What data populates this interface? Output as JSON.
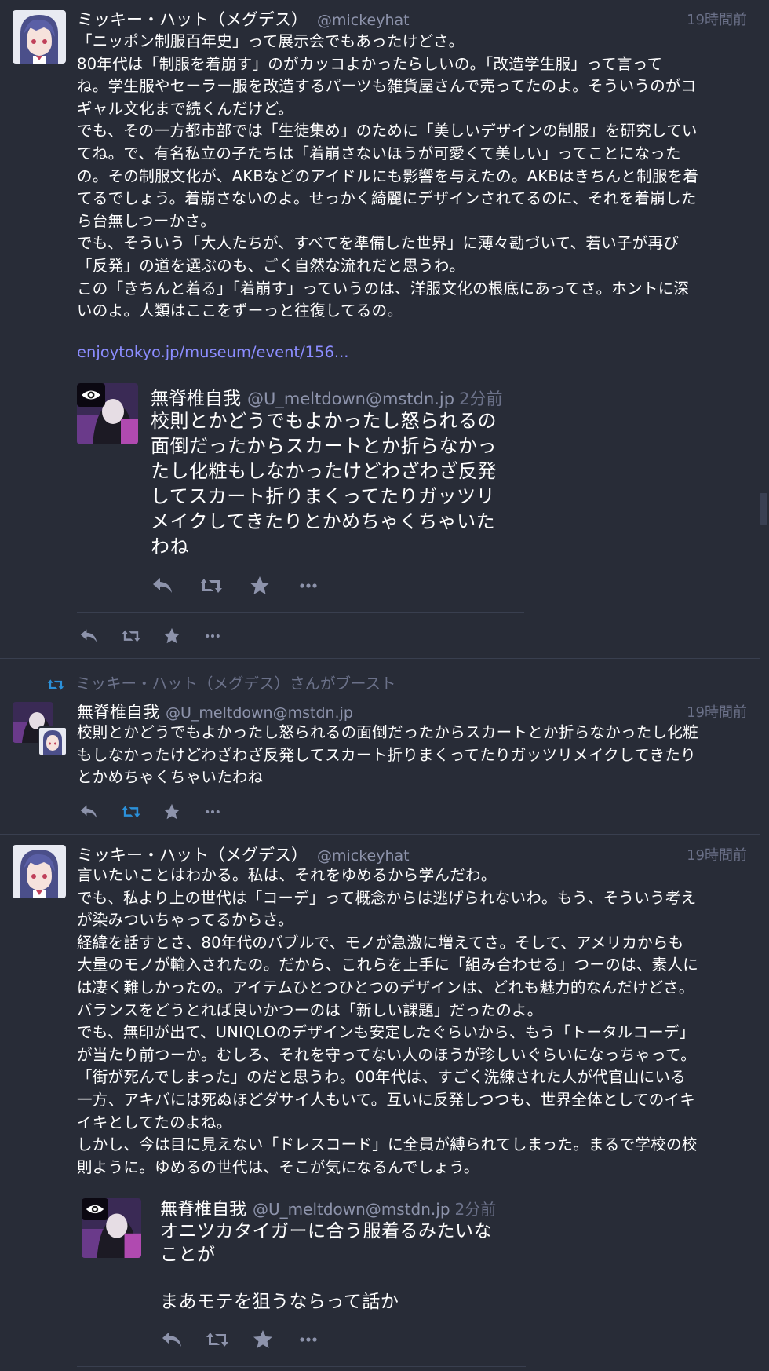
{
  "colors": {
    "background": "#282c37",
    "text": "#ffffff",
    "muted": "#6b7189",
    "handle": "#8d93ab",
    "link": "#8c8dff",
    "boost_active": "#2b90d9"
  },
  "posts": [
    {
      "author": "ミッキー・ハット（メグデス）",
      "handle": "@mickeyhat",
      "time": "19時間前",
      "text": "「ニッポン制服百年史」って展示会でもあったけどさ。\n80年代は「制服を着崩す」のがカッコよかったらしいの。「改造学生服」って言って\nね。学生服やセーラー服を改造するパーツも雑貨屋さんで売ってたのよ。そういうのがコ\nギャル文化まで続くんだけど。\nでも、その一方都市部では「生徒集め」のために「美しいデザインの制服」を研究してい\nてね。で、有名私立の子たちは「着崩さないほうが可愛くて美しい」ってことになった\nの。その制服文化が、AKBなどのアイドルにも影響を与えたの。AKBはきちんと制服を着\nてるでしょう。着崩さないのよ。せっかく綺麗にデザインされてるのに、それを着崩した\nら台無しつーかさ。\nでも、そういう「大人たちが、すべてを準備した世界」に薄々勘づいて、若い子が再び\n「反発」の道を選ぶのも、ごく自然な流れだと思うわ。\nこの「きちんと着る」「着崩す」っていうのは、洋服文化の根底にあってさ。ホントに深\nいのよ。人類はここをずーっと往復してるの。",
      "link": "enjoytokyo.jp/museum/event/156...",
      "quote": {
        "author": "無脊椎自我",
        "handle": "@U_meltdown@mstdn.jp",
        "time": "2分前",
        "text": "校則とかどうでもよかったし怒られるの\n面倒だったからスカートとか折らなかっ\nたし化粧もしなかったけどわざわざ反発\nしてスカート折りまくってたりガッツリ\nメイクしてきたりとかめちゃくちゃいた\nわね"
      }
    },
    {
      "boost_label": "ミッキー・ハット（メグデス）さんがブースト",
      "author": "無脊椎自我",
      "handle": "@U_meltdown@mstdn.jp",
      "time": "19時間前",
      "text": "校則とかどうでもよかったし怒られるの面倒だったからスカートとか折らなかったし化粧\nもしなかったけどわざわざ反発してスカート折りまくってたりガッツリメイクしてきたり\nとかめちゃくちゃいたわね"
    },
    {
      "author": "ミッキー・ハット（メグデス）",
      "handle": "@mickeyhat",
      "time": "19時間前",
      "text": "言いたいことはわかる。私は、それをゆめるから学んだわ。\nでも、私より上の世代は「コーデ」って概念からは逃げられないわ。もう、そういう考え\nが染みついちゃってるからさ。\n経緯を話すとさ、80年代のバブルで、モノが急激に増えてさ。そして、アメリカからも\n大量のモノが輸入されたの。だから、これらを上手に「組み合わせる」つーのは、素人に\nは凄く難しかったの。アイテムひとつひとつのデザインは、どれも魅力的なんだけどさ。\nバランスをどうとれば良いかつーのは「新しい課題」だったのよ。\nでも、無印が出て、UNIQLOのデザインも安定したぐらいから、もう「トータルコーデ」\nが当たり前つーか。むしろ、それを守ってない人のほうが珍しいぐらいになっちゃって。\n「街が死んでしまった」のだと思うわ。00年代は、すごく洗練された人が代官山にいる\n一方、アキバには死ぬほどダサイ人もいて。互いに反発しつつも、世界全体としてのイキ\nイキとしてたのよね。\nしかし、今は目に見えない「ドレスコード」に全員が縛られてしまった。まるで学校の校\n則ように。ゆめるの世代は、そこが気になるんでしょう。",
      "quote": {
        "author": "無脊椎自我",
        "handle": "@U_meltdown@mstdn.jp",
        "time": "2分前",
        "text": "オニツカタイガーに合う服着るみたいな\nことが\n\nまあモテを狙うならって話か"
      }
    }
  ]
}
